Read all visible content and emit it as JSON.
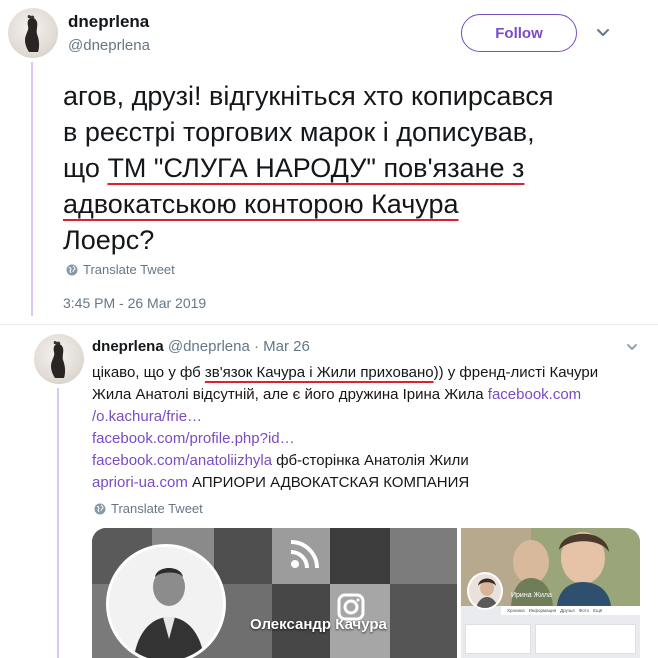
{
  "main_tweet": {
    "author_name": "dneprlena",
    "author_handle": "@dneprlena",
    "follow_label": "Follow",
    "text_lines": [
      {
        "parts": [
          {
            "text": "агов, друзі! відгукніться хто копирсався",
            "underline": false
          }
        ]
      },
      {
        "parts": [
          {
            "text": "в реєстрі торгових марок і дописував,",
            "underline": false
          }
        ]
      },
      {
        "parts": [
          {
            "text": "що ",
            "underline": false
          },
          {
            "text": "ТМ \"СЛУГА НАРОДУ\" пов'язане з",
            "underline": true
          }
        ]
      },
      {
        "parts": [
          {
            "text": "адвокатською конторою Качура",
            "underline": true
          }
        ]
      },
      {
        "parts": [
          {
            "text": "Лоерс?",
            "underline": false
          }
        ]
      }
    ],
    "translate_label": "Translate Tweet",
    "timestamp": "3:45 PM - 26 Mar 2019"
  },
  "reply_tweet": {
    "author_name": "dneprlena",
    "author_handle": "@dneprlena",
    "separator": "·",
    "date": "Mar 26",
    "lines": [
      [
        {
          "text": "цікаво, що у фб ",
          "type": "text"
        },
        {
          "text": "зв'язок Качура і Жили приховано",
          "type": "underline"
        },
        {
          "text": ")) у френд-листі Качури",
          "type": "text"
        }
      ],
      [
        {
          "text": "Жила Анатолі відсутній, але є його дружина Ірина Жила ",
          "type": "text"
        },
        {
          "text": "facebook.com",
          "type": "link"
        }
      ],
      [
        {
          "text": "/o.kachura/frie…",
          "type": "link"
        }
      ],
      [
        {
          "text": "facebook.com/profile.php?id…",
          "type": "link"
        }
      ],
      [
        {
          "text": "facebook.com/anatoliizhyla",
          "type": "link"
        },
        {
          "text": " фб-сторінка Анатолія Жили",
          "type": "text"
        }
      ],
      [
        {
          "text": "apriori-ua.com",
          "type": "link"
        },
        {
          "text": " АПРИОРИ АДВОКАТСКАЯ КОМПАНИЯ",
          "type": "text"
        }
      ]
    ],
    "translate_label": "Translate Tweet"
  },
  "media": {
    "left_name": "Олександр Качура",
    "right_name": "Ирина Жила",
    "right_tabs": [
      "Хроника",
      "Информация",
      "Друзья",
      "Фото",
      "Ещё"
    ]
  },
  "colors": {
    "accent": "#794bc4",
    "thread_line": "#d9c8f0",
    "underline_red": "#e02030",
    "secondary_text": "#657786"
  },
  "icons": [
    "globe-icon",
    "chevron-down-icon",
    "rss-icon",
    "camera-icon",
    "user-avatar"
  ]
}
